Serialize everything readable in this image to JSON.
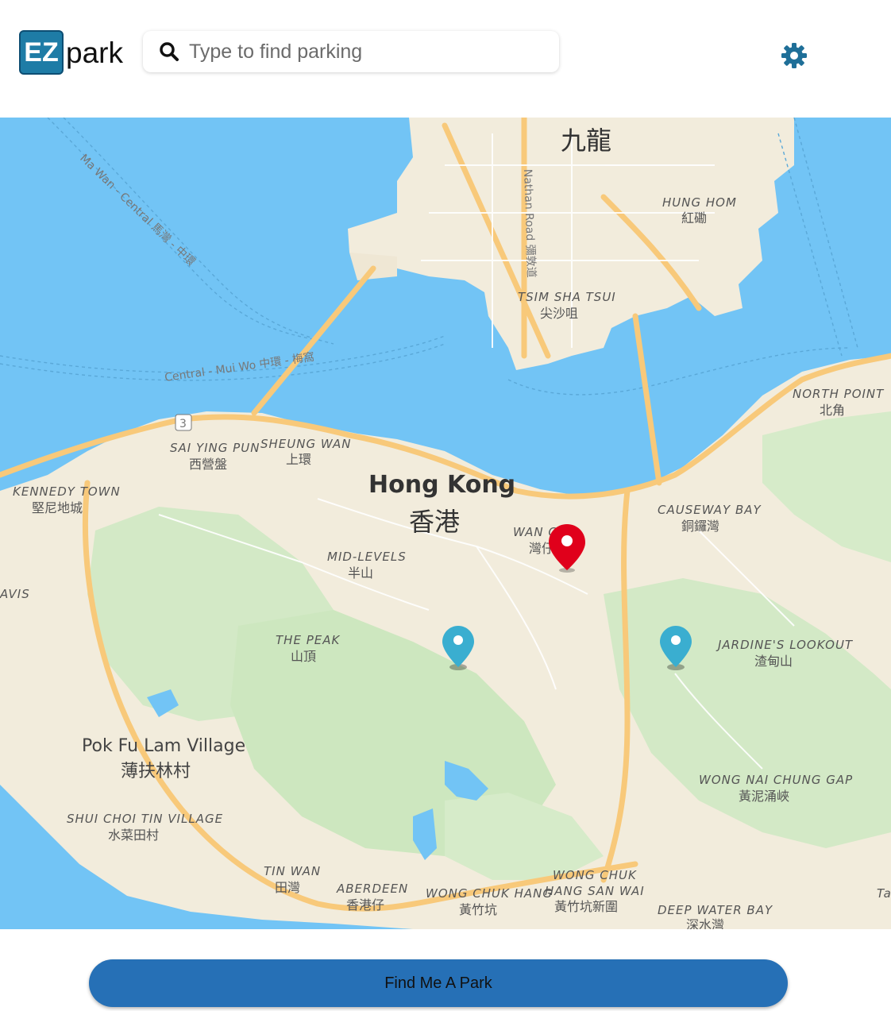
{
  "app": {
    "logo_box_text": "EZ",
    "logo_text": "park"
  },
  "search": {
    "placeholder": "Type to find parking",
    "icon": "search-icon"
  },
  "settings": {
    "icon": "gear-icon"
  },
  "map": {
    "labels": {
      "kowloon": "九龍",
      "nathan_road": "Nathan Road 彌敦道",
      "hung_hom": "HUNG HOM",
      "hung_hom_cjk": "紅磡",
      "tsim_sha_tsui": "TSIM SHA TSUI",
      "tsim_sha_tsui_cjk": "尖沙咀",
      "ferry_ma_wan": "Ma Wan - Central 馬灣 - 中環",
      "ferry_mui_wo": "Central - Mui Wo 中環 - 梅窩",
      "north_point": "NORTH POINT",
      "north_point_cjk": "北角",
      "route_3": "3",
      "sai_ying_pun": "SAI YING PUN",
      "sai_ying_pun_cjk": "西營盤",
      "sheung_wan": "SHEUNG WAN",
      "sheung_wan_cjk": "上環",
      "hong_kong": "Hong Kong",
      "hong_kong_cjk": "香港",
      "kennedy_town": "KENNEDY TOWN",
      "kennedy_town_cjk": "堅尼地城",
      "causeway_bay": "CAUSEWAY BAY",
      "causeway_bay_cjk": "銅鑼灣",
      "wan_chai": "WAN C",
      "wan_chai_cjk": "灣仔",
      "mid_levels": "MID-LEVELS",
      "mid_levels_cjk": "半山",
      "avis": "AVIS",
      "the_peak": "THE PEAK",
      "the_peak_cjk": "山頂",
      "jardines_lookout": "JARDINE'S LOOKOUT",
      "jardines_lookout_cjk": "渣甸山",
      "pok_fu_lam": "Pok Fu Lam Village",
      "pok_fu_lam_cjk": "薄扶林村",
      "wong_nai_chung": "WONG NAI CHUNG GAP",
      "wong_nai_chung_cjk": "黃泥涌峽",
      "shui_choi_tin": "SHUI CHOI TIN VILLAGE",
      "shui_choi_tin_cjk": "水菜田村",
      "tin_wan": "TIN WAN",
      "tin_wan_cjk": "田灣",
      "aberdeen": "ABERDEEN",
      "aberdeen_cjk": "香港仔",
      "wong_chuk_hang": "WONG CHUK HANG",
      "wong_chuk_hang_cjk": "黃竹坑",
      "wong_chuk_hang_san_wai_1": "WONG CHUK",
      "wong_chuk_hang_san_wai_2": "HANG SAN WAI",
      "wong_chuk_hang_san_wai_cjk": "黃竹坑新圍",
      "deep_water_bay": "DEEP WATER BAY",
      "deep_water_bay_cjk": "深水灣",
      "edge_ta": "Ta"
    },
    "markers": [
      {
        "name": "current-location",
        "color": "#e0001b"
      },
      {
        "name": "parking-peak",
        "color": "#3aaed0"
      },
      {
        "name": "parking-jardines-lookout",
        "color": "#3aaed0"
      }
    ]
  },
  "footer": {
    "find_button_label": "Find Me A Park"
  },
  "colors": {
    "brand": "#1e7ca6",
    "button": "#2670b6",
    "water": "#6fc3f5",
    "land": "#f2ecdc",
    "park": "#cde8c0",
    "road": "#f8c97a"
  }
}
